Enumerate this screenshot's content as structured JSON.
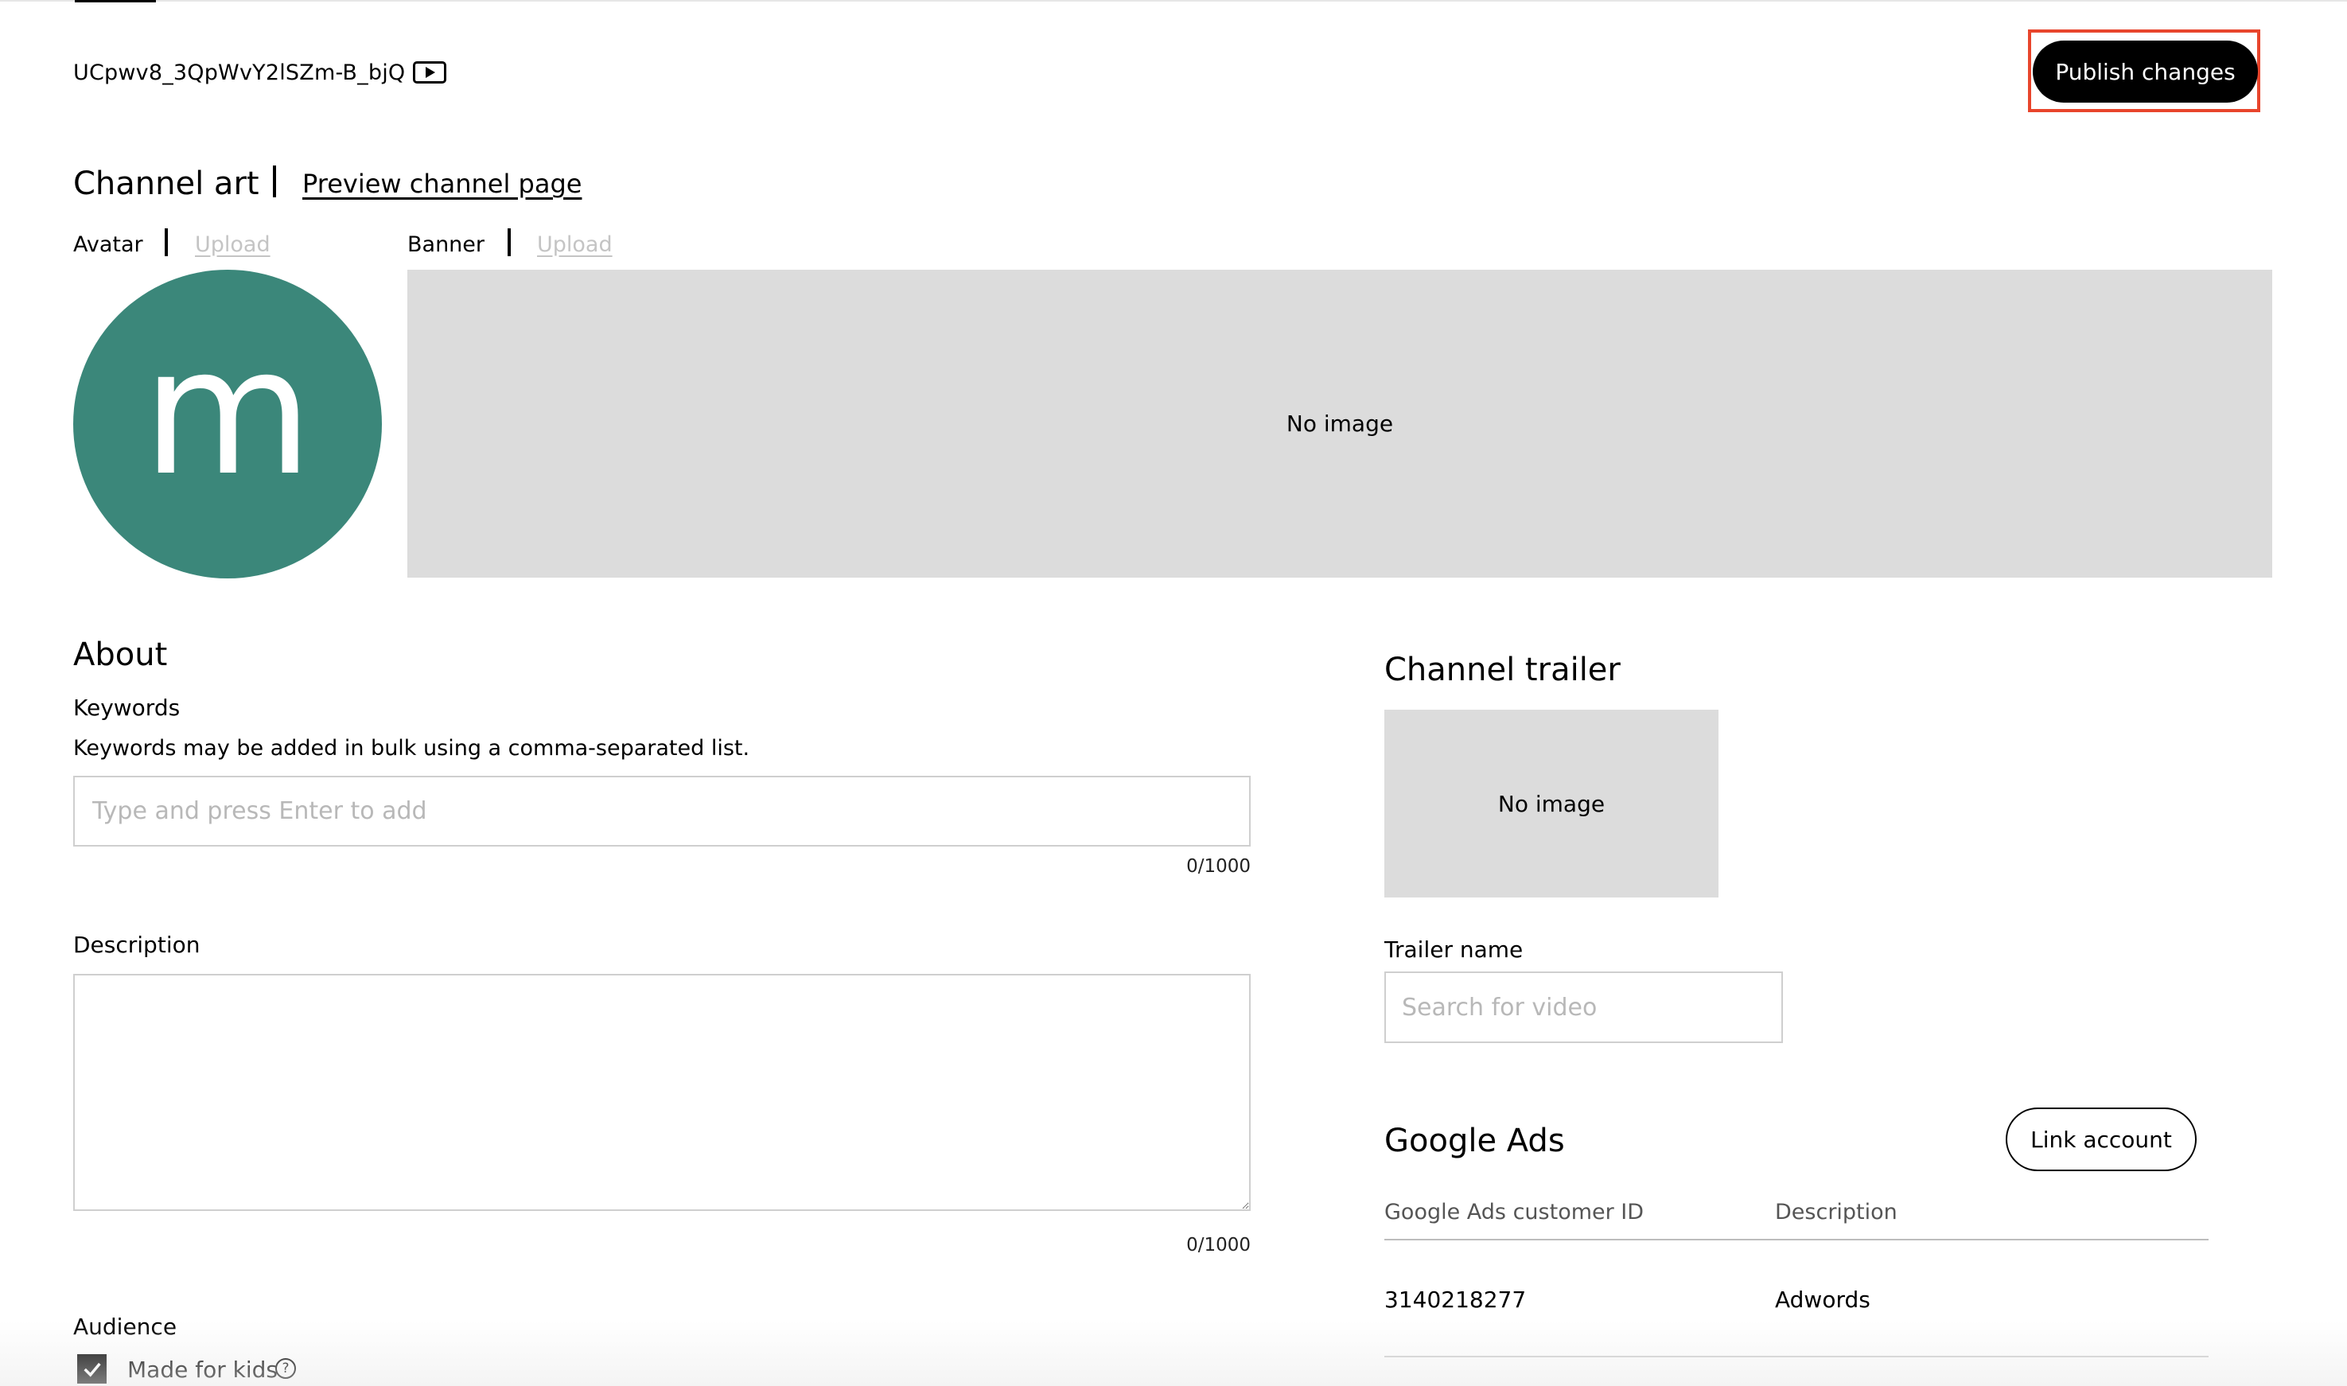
{
  "header": {
    "channel_id": "UCpwv8_3QpWvY2lSZm-B_bjQ",
    "channel_icon": "youtube-play-icon",
    "publish_label": "Publish changes",
    "highlight_color": "#e8452c"
  },
  "channel_art": {
    "title": "Channel art",
    "preview_link": "Preview channel page",
    "avatar_label": "Avatar",
    "avatar_upload": "Upload",
    "avatar_letter": "m",
    "avatar_color": "#3b877a",
    "banner_label": "Banner",
    "banner_upload": "Upload",
    "banner_placeholder": "No image"
  },
  "about": {
    "title": "About",
    "keywords_label": "Keywords",
    "keywords_help": "Keywords may be added in bulk using a comma-separated list.",
    "keywords_placeholder": "Type and press Enter to add",
    "keywords_count": "0/1000",
    "description_label": "Description",
    "description_count": "0/1000",
    "audience_label": "Audience",
    "made_for_kids_label": "Made for kids",
    "made_for_kids_checked": true
  },
  "channel_trailer": {
    "title": "Channel trailer",
    "placeholder": "No image",
    "trailer_name_label": "Trailer name",
    "search_placeholder": "Search for video"
  },
  "google_ads": {
    "title": "Google Ads",
    "link_button": "Link account",
    "columns": [
      "Google Ads customer ID",
      "Description"
    ],
    "rows": [
      {
        "customer_id": "3140218277",
        "description": "Adwords"
      }
    ]
  }
}
